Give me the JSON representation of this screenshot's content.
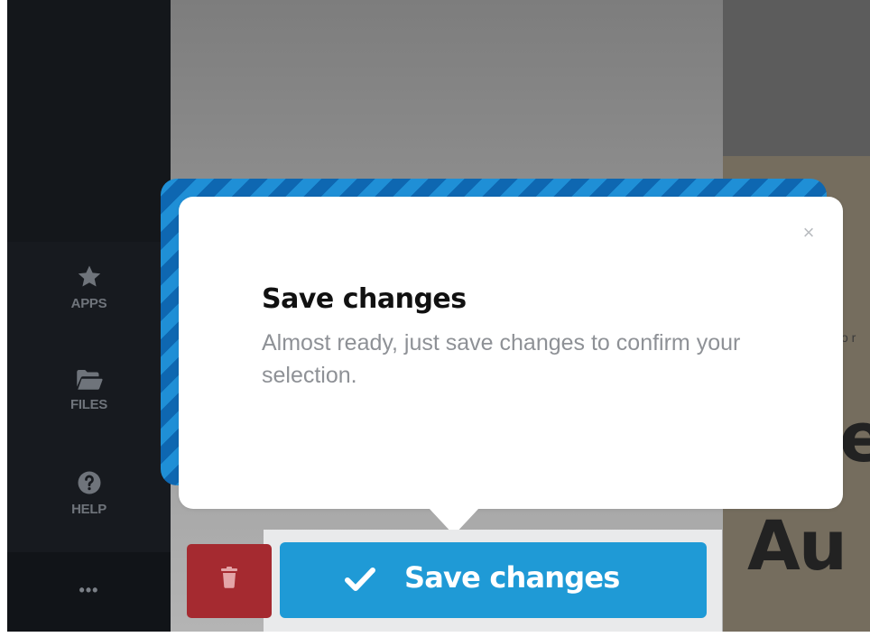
{
  "sidebar": {
    "items": [
      {
        "label": "APPS",
        "icon": "star-icon"
      },
      {
        "label": "FILES",
        "icon": "folder-open-icon"
      },
      {
        "label": "HELP",
        "icon": "question-circle-icon"
      }
    ],
    "more_label": "•••"
  },
  "background": {
    "heading_fragment": "Au",
    "heading_fragment_2": "e",
    "faint_fragment": "o r"
  },
  "popover": {
    "title": "Save changes",
    "body": "Almost ready, just save changes to confirm your selection.",
    "close_glyph": "×"
  },
  "actions": {
    "save_label": "Save changes",
    "delete_icon": "trash-icon",
    "save_icon": "check-icon"
  },
  "colors": {
    "accent": "#1f9ad6",
    "stripe_dark": "#0e67b1",
    "danger": "#a52a30",
    "sidebar_bg": "#171a1f"
  }
}
